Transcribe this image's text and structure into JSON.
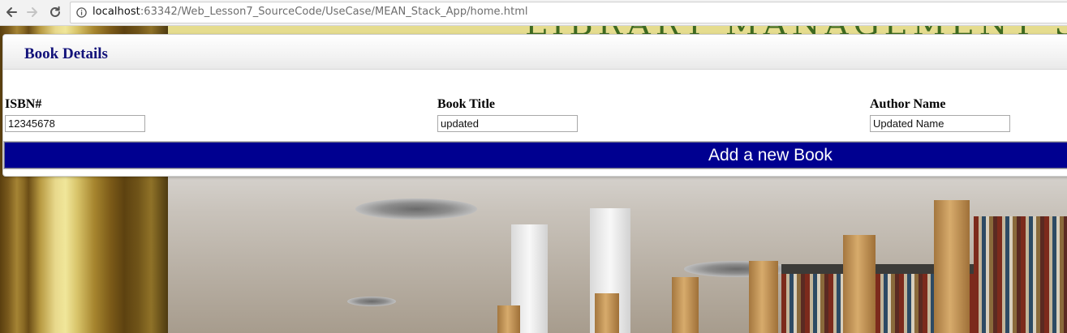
{
  "browser": {
    "url_host": "localhost",
    "url_path": ":63342/Web_Lesson7_SourceCode/UseCase/MEAN_Stack_App/home.html",
    "icons": [
      "back-arrow-icon",
      "forward-arrow-icon",
      "reload-icon",
      "info-icon"
    ]
  },
  "panel": {
    "title": "Book Details",
    "fields": [
      {
        "label": "ISBN#",
        "value": "12345678"
      },
      {
        "label": "Book Title",
        "value": "updated"
      },
      {
        "label": "Author Name",
        "value": "Updated Name"
      }
    ],
    "add_button_label": "Add a new Book"
  },
  "colors": {
    "title_text": "#12127a",
    "button_bg": "#000090",
    "button_text": "#ffffff"
  }
}
